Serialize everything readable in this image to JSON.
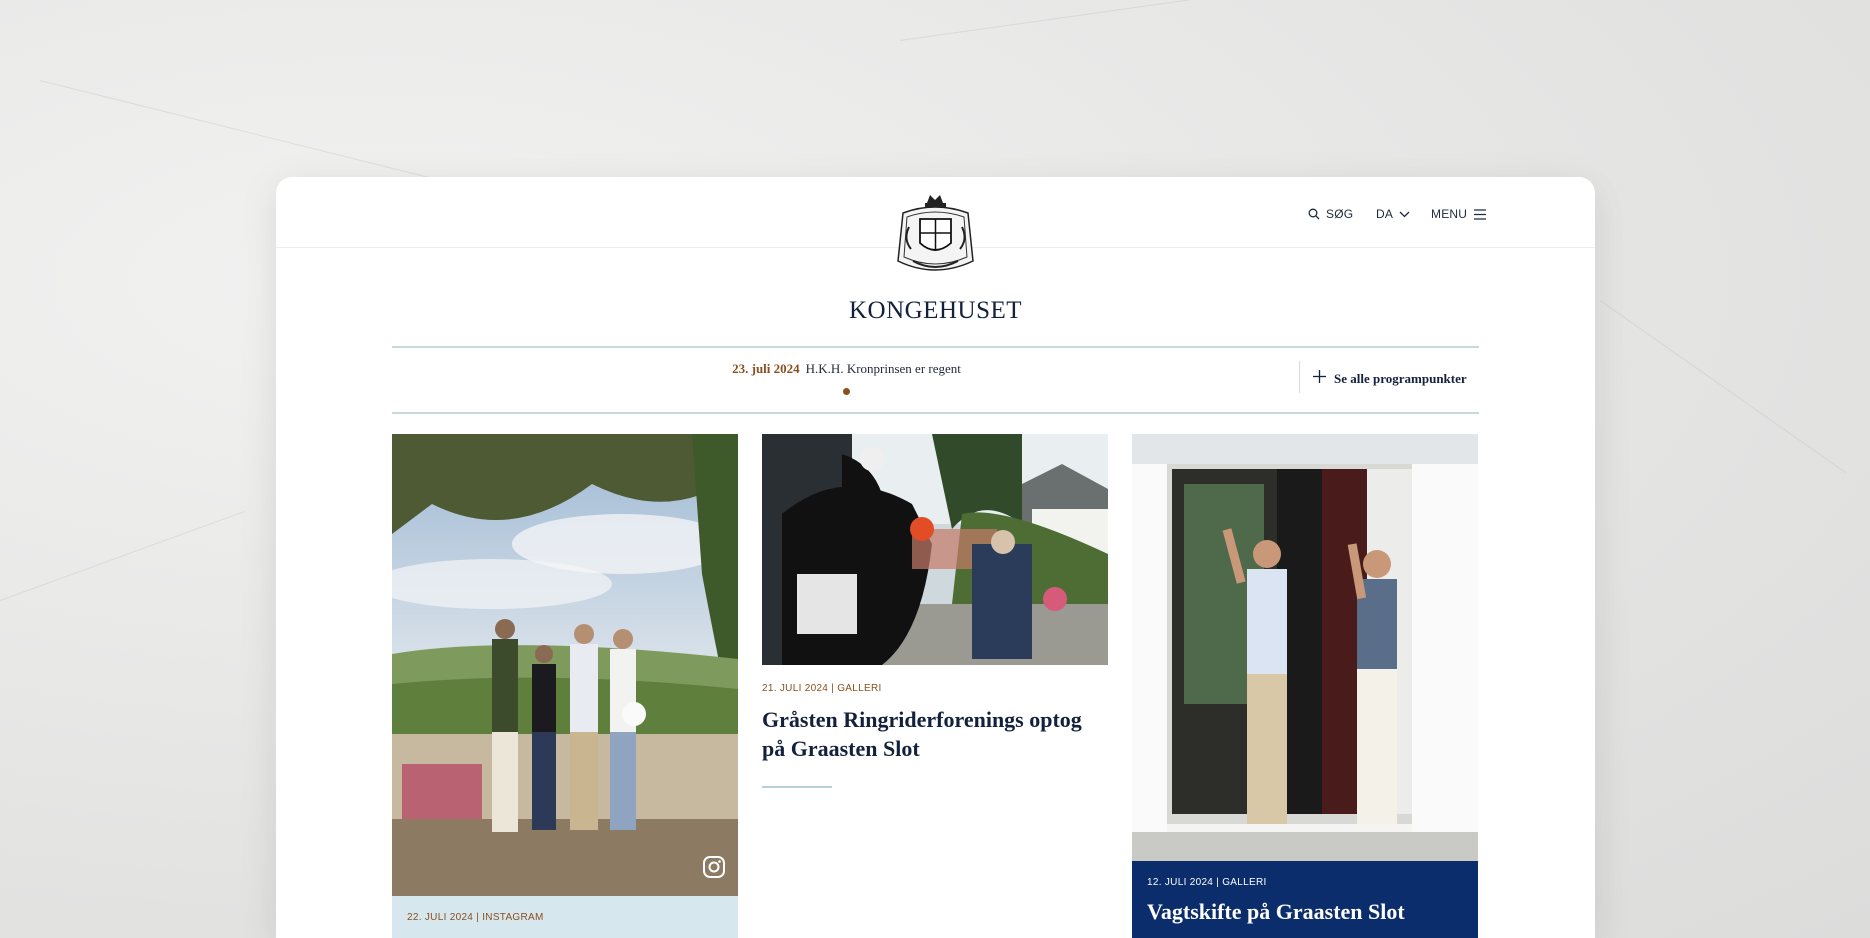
{
  "nav": {
    "search_label": "SØG",
    "lang_label": "DA",
    "menu_label": "MENU"
  },
  "brand": {
    "title": "KONGEHUSET"
  },
  "program": {
    "date": "23. juli 2024",
    "text": "H.K.H. Kronprinsen er regent",
    "see_all_label": "Se alle programpunkter"
  },
  "cards": [
    {
      "meta": "22. JULI 2024 | INSTAGRAM",
      "title": ""
    },
    {
      "meta": "21. JULI 2024 | GALLERI",
      "title": "Gråsten Ringriderforenings optog på Graasten Slot"
    },
    {
      "meta": "12. JULI 2024 | GALLERI",
      "title": "Vagtskifte på Graasten Slot"
    }
  ],
  "colors": {
    "accent": "#8a4f1d",
    "navy": "#0b2d6b",
    "divider": "#c8d9dc",
    "light_blue_panel": "#d7e7ee"
  },
  "icons": [
    "search-icon",
    "chevron-down-icon",
    "menu-icon",
    "crest-logo",
    "plus-icon",
    "instagram-icon"
  ]
}
